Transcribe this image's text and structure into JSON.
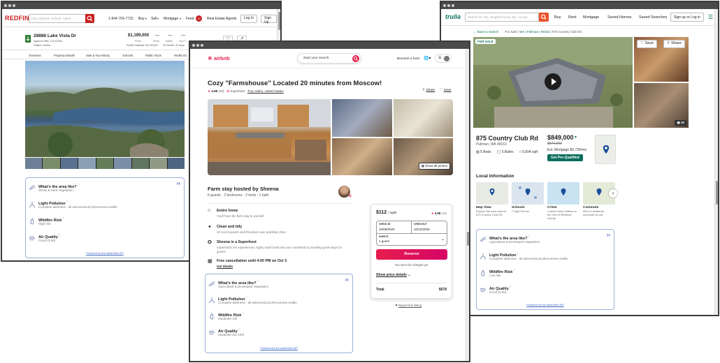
{
  "redfin": {
    "logo": "REDFIN",
    "search_placeholder": "City, Address, School, Agent",
    "phone": "1-844-759-7732",
    "nav": [
      "Buy",
      "Sell",
      "Mortgage",
      "Feed"
    ],
    "feed_badge": "10",
    "agents": "Real Estate Agents",
    "login": "Log In",
    "signup": "Sign Up",
    "address": "28886 Lake Vista Dr",
    "city": "Agoura Hills, CA 91301",
    "status": "Status: Active",
    "price": "$1,199,000",
    "price_label": "Price",
    "beds": "—",
    "beds_label": "Beds",
    "baths": "—",
    "baths_label": "Baths",
    "sqft": "—",
    "sqft_label": "Sq Ft",
    "estimate": "Redfin Estimate: $2,153,607",
    "on_redfin": "On Redfin: 22 days",
    "tabs": [
      "Overview",
      "Property Details",
      "Sale & Tax History",
      "Schools",
      "Public Facts",
      "Redfin Es"
    ],
    "card": {
      "rows": [
        {
          "title": "What's the area like?",
          "value": "Shrub & Herb Vegetation"
        },
        {
          "title": "Light Pollution",
          "value": "Complete darkness - all astronomical phenomena visible"
        },
        {
          "title": "Wildfire Risk",
          "value": "High risk"
        },
        {
          "title": "Air Quality",
          "value": "Good (0-50)"
        }
      ],
      "powered": "Powered by the kaizEmith API"
    }
  },
  "airbnb": {
    "logo": "airbnb",
    "search": "Start your search",
    "host": "Become a host",
    "title": "Cozy \"Farmshouse\" Located 20 minutes from Moscow!",
    "rating": "4.98",
    "reviews": "(43)",
    "superhost": "Superhost",
    "location": "Troy, Idaho, United States",
    "share": "Share",
    "save": "Save",
    "show_photos": "Show all photos",
    "hosted": "Farm stay hosted by Sheena",
    "details": "6 guests · 2 bedrooms · 2 beds · 1 bath",
    "features": [
      {
        "title": "Entire home",
        "desc": "You'll have the farm stay to yourself."
      },
      {
        "title": "Clean and tidy",
        "desc": "18 recent guests said this place was sparkling clean."
      },
      {
        "title": "Sheena is a Superhost",
        "desc": "Superhosts are experienced, highly rated hosts who are committed to providing great stays for guests."
      },
      {
        "title": "Free cancellation until 4:00 PM on Oct 3",
        "desc": "Get details"
      }
    ],
    "booking": {
      "price": "$112",
      "per_night": "/ night",
      "rating": "4.98",
      "reviews": "(43)",
      "checkin_label": "CHECK-IN",
      "checkin": "10/08/2020",
      "checkout_label": "CHECKOUT",
      "checkout": "10/12/2020",
      "guests_label": "GUESTS",
      "guests": "1 guest",
      "reserve": "Reserve",
      "note": "You won't be charged yet",
      "breakdown": "Show price details",
      "total_label": "Total",
      "total": "$578",
      "report": "Report this listing"
    },
    "card": {
      "rows": [
        {
          "title": "What's the area like?",
          "value": "Agricultural & Developed Vegetation"
        },
        {
          "title": "Light Pollution",
          "value": "Complete darkness - all astronomical phenomena visible"
        },
        {
          "title": "Wildfire Risk",
          "value": "Moderate risk"
        },
        {
          "title": "Air Quality",
          "value": "Moderate (51-100)"
        }
      ],
      "powered": "Powered by the kaizEmith API"
    }
  },
  "trulia": {
    "logo": "trulia",
    "search_placeholder": "Search for City, Neighborhood, Zip, County",
    "nav": [
      "Buy",
      "Rent",
      "Mortgage",
      "Saved Homes",
      "Saved Searches"
    ],
    "login": "Sign up or Log in",
    "back": "Back to Search",
    "crumbs": [
      "For Sale",
      "WA",
      "Pullman",
      "99163",
      "875 Country Club Rd"
    ],
    "for_sale": "FOR SALE",
    "save": "Save",
    "share": "Share",
    "photo_count": "30",
    "address": "875 Country Club Rd",
    "city": "Pullman, WA 99163",
    "beds": "5 Beds",
    "baths": "5 Baths",
    "sqft": "5,694 sqft",
    "price": "$849,000",
    "old_price": "$879,000",
    "mortgage": "Est. Mortgage $3,726/mo",
    "prequal": "Get Pre-Qualified",
    "local_info": "Local Information",
    "maps": [
      {
        "title": "Map View",
        "desc": "Explore the area around 875 Country Club Rd"
      },
      {
        "title": "Schools",
        "desc": "7 High School"
      },
      {
        "title": "Crime",
        "desc": "Lowest crime relative to the rest of Whitman county"
      },
      {
        "title": "Commute",
        "desc": "69% of residents commute by car"
      }
    ],
    "card": {
      "rows": [
        {
          "title": "What's the area like?",
          "value": "Agricultural & Developed Vegetation"
        },
        {
          "title": "Light Pollution",
          "value": "Complete darkness - all astronomical phenomena visible"
        },
        {
          "title": "Wildfire Risk",
          "value": "Low risk"
        },
        {
          "title": "Air Quality",
          "value": "Good (0-50)"
        }
      ],
      "powered": "Powered by the kaizEmith API"
    }
  },
  "colors": {
    "redfin": "#c82021",
    "airbnb": "#e61e4d",
    "trulia": "#0a6e5c",
    "card_border": "#9db0d8"
  }
}
